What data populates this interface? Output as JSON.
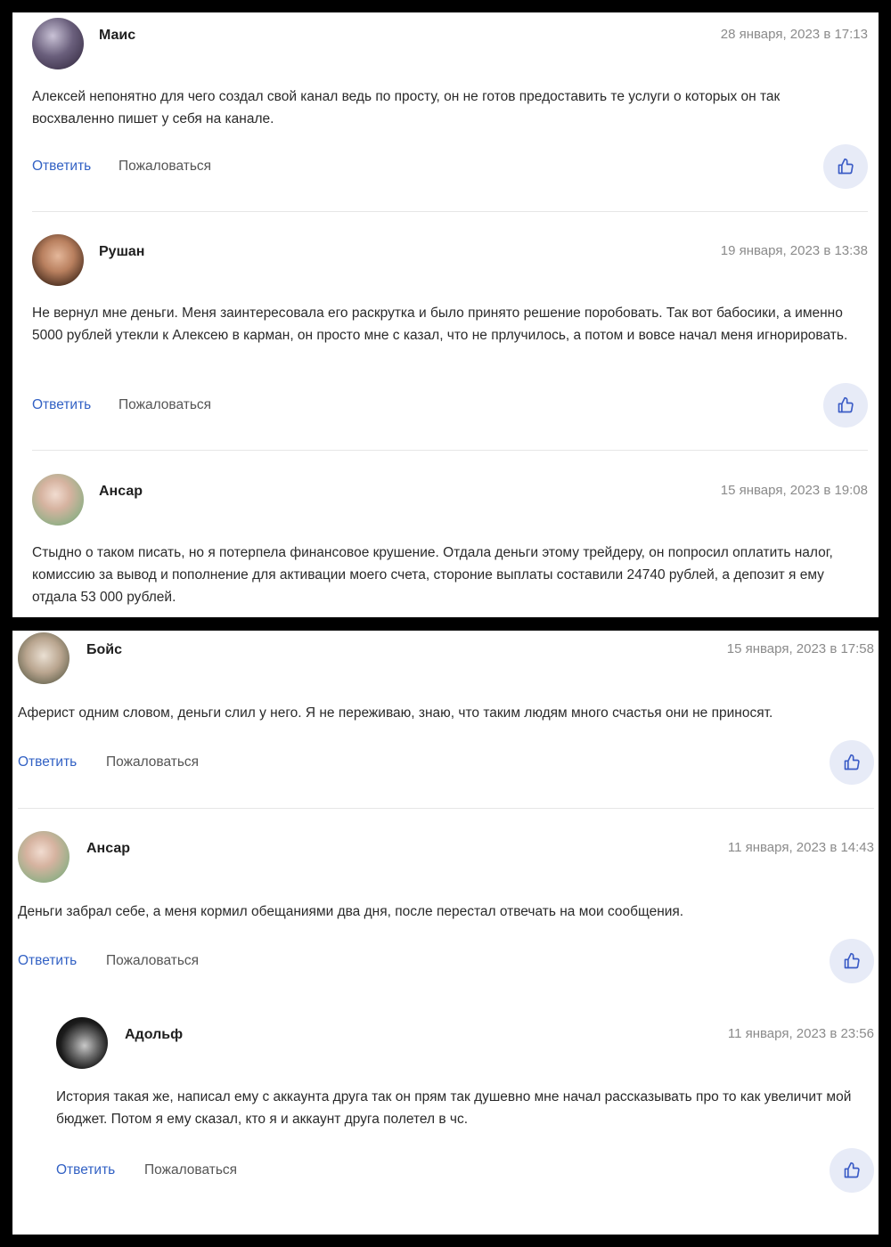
{
  "actions": {
    "reply": "Ответить",
    "report": "Пожаловаться"
  },
  "comments": [
    {
      "author": "Маис",
      "date": "28 января, 2023 в 17:13",
      "text": "Алексей непонятно для чего создал свой канал ведь по просту, он не готов предоставить те услуги о которых он так восхваленно пишет у себя на канале."
    },
    {
      "author": "Рушан",
      "date": "19 января, 2023 в 13:38",
      "text": "Не вернул мне деньги. Меня заинтересовала его раскрутка и было принято решение поробовать. Так вот бабосики, а именно 5000 рублей утекли к Алексею в карман, он просто мне с казал, что не прлучилось, а потом и вовсе начал меня игнорировать."
    },
    {
      "author": "Ансар",
      "date": "15 января, 2023 в 19:08",
      "text": "Стыдно о таком писать, но я потерпела финансовое крушение. Отдала деньги этому трейдеру, он попросил оплатить налог, комиссию за вывод и пополнение для активации моего счета, стороние выплаты составили 24740 рублей, а депозит я ему отдала 53 000 рублей."
    },
    {
      "author": "Бойс",
      "date": "15 января, 2023 в 17:58",
      "text": "Аферист одним словом, деньги слил у него. Я не переживаю, знаю, что таким людям много счастья они не приносят."
    },
    {
      "author": "Ансар",
      "date": "11 января, 2023 в 14:43",
      "text": "Деньги забрал себе, а меня кормил обещаниями два дня, после перестал отвечать на мои сообщения."
    },
    {
      "author": "Адольф",
      "date": "11 января, 2023 в 23:56",
      "text": "История такая же, написал ему с аккаунта друга так он прям так душевно мне начал рассказывать про то как увеличит мой бюджет. Потом я ему сказал, кто я и аккаунт друга полетел в чс."
    }
  ],
  "colors": {
    "link": "#3261c4",
    "like_bg": "#e7ebf7",
    "date": "#8b8b8b"
  },
  "icons": {
    "like": "thumbs-up-icon"
  }
}
